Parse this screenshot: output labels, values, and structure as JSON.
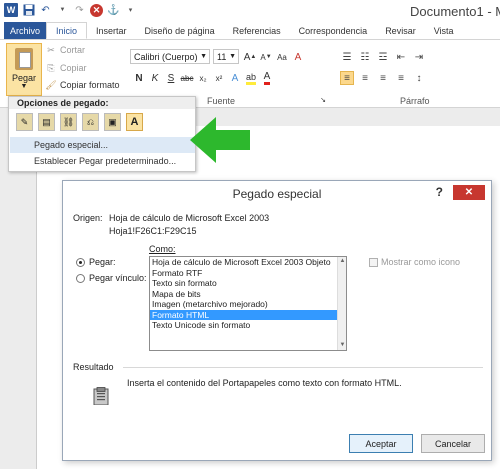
{
  "window": {
    "title": "Documento1 - M"
  },
  "tabs": [
    "Archivo",
    "Inicio",
    "Insertar",
    "Diseño de página",
    "Referencias",
    "Correspondencia",
    "Revisar",
    "Vista"
  ],
  "clipboard": {
    "paste_label": "Pegar",
    "cut_label": "Cortar",
    "copy_label": "Copiar",
    "format_painter_label": "Copiar formato"
  },
  "font": {
    "name": "Calibri (Cuerpo)",
    "size": "11",
    "group_label": "Fuente"
  },
  "paragraph": {
    "group_label": "Párrafo"
  },
  "paste_menu": {
    "header": "Opciones de pegado:",
    "item1": "Pegado especial...",
    "item2": "Establecer Pegar predeterminado..."
  },
  "dialog": {
    "title": "Pegado especial",
    "help": "?",
    "origin_label": "Origen:",
    "origin_line1": "Hoja de cálculo de Microsoft Excel 2003",
    "origin_line2": "Hoja1!F26C1:F29C15",
    "as_label": "Como:",
    "paste_radio": "Pegar:",
    "paste_link_radio": "Pegar vínculo:",
    "formats": [
      "Hoja de cálculo de Microsoft Excel 2003 Objeto",
      "Formato RTF",
      "Texto sin formato",
      "Mapa de bits",
      "Imagen (metarchivo mejorado)",
      "Formato HTML",
      "Texto Unicode sin formato"
    ],
    "selected_format": "Formato HTML",
    "show_icon_label": "Mostrar como icono",
    "result_label": "Resultado",
    "result_text": "Inserta el contenido del Portapapeles como texto con formato HTML.",
    "ok_label": "Aceptar",
    "cancel_label": "Cancelar"
  },
  "colors": {
    "accent": "#2b579a",
    "highlight": "#fbe3a3",
    "selection": "#3399ff",
    "arrow": "#2db82d",
    "close": "#c7372f"
  }
}
